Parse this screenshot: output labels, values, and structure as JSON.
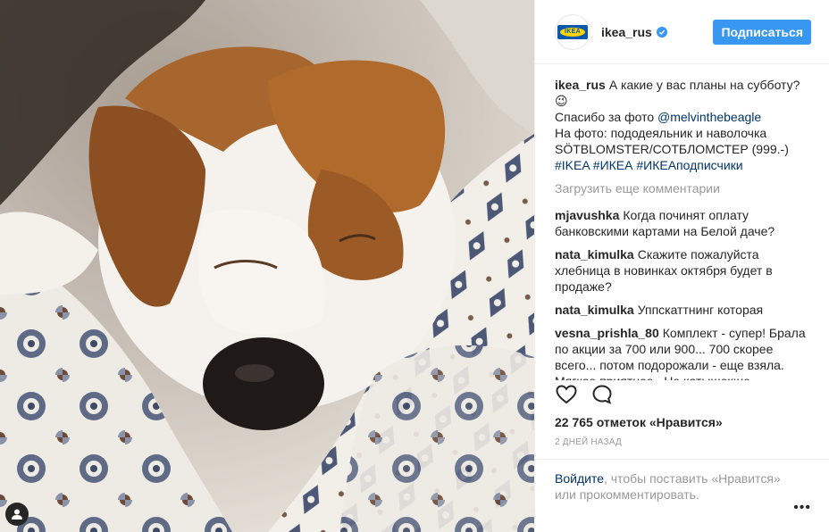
{
  "header": {
    "username": "ikea_rus",
    "avatar_text": "IKEA",
    "follow_label": "Подписаться"
  },
  "caption": {
    "user": "ikea_rus",
    "line1": "А какие у вас планы на субботу? 😉",
    "thanks": "Спасибо за фото",
    "mention": "@melvinthebeagle",
    "line3": "На фото: пододеяльник и наволочка SÖTBLOMSTER/СОТБЛОМСТЕР (999.-)",
    "hashtags": "#IKEA #ИКЕА #ИКЕАподписчики"
  },
  "load_more": "Загрузить еще комментарии",
  "comments": [
    {
      "user": "mjavushka",
      "text": "Когда починят оплату банковскими картами на Белой даче?"
    },
    {
      "user": "nata_kimulka",
      "text": "Скажите пожалуйста хлебница в новинках октября будет в продаже?"
    },
    {
      "user": "nata_kimulka",
      "text": "Уппскаттнинг которая"
    },
    {
      "user": "vesna_prishla_80",
      "text": "Комплект - супер! Брала по акции за 700 или 900... 700 скорее всего... потом подорожали - еще взяла. Мягкое,приятное , Не катышек:не"
    }
  ],
  "likes": "22 765 отметок «Нравится»",
  "timestamp": "2 ДНЕЙ НАЗАД",
  "login": {
    "link": "Войдите",
    "text": ", чтобы поставить «Нравится» или прокомментировать."
  },
  "more_label": "•••",
  "icons": {
    "like": "heart-icon",
    "comment": "speech-bubble-icon",
    "tag": "person-tag-icon",
    "verified": "verified-badge-icon"
  },
  "colors": {
    "accent": "#3897f0",
    "link": "#003569",
    "muted": "#999999",
    "text": "#262626"
  }
}
